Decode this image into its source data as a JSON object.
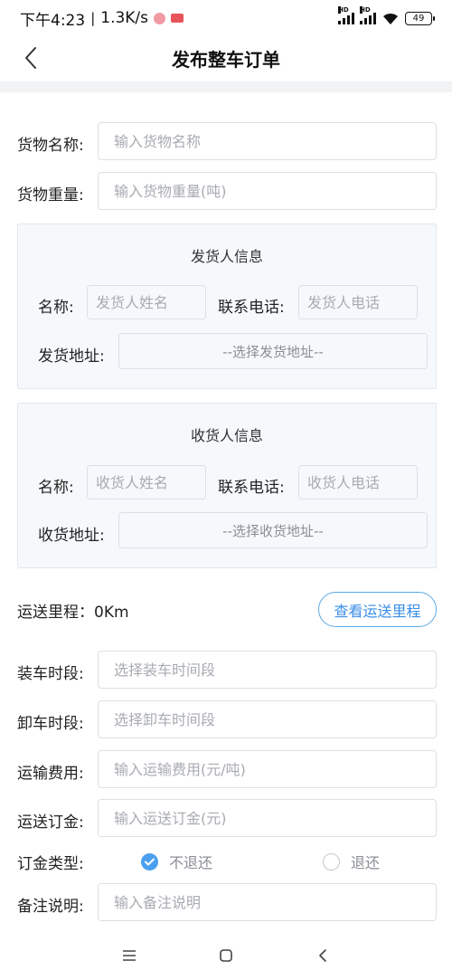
{
  "status_bar": {
    "time": "下午4:23",
    "speed": "1.3K/s",
    "battery": "49",
    "hd_label": "HD"
  },
  "header": {
    "title": "发布整车订单"
  },
  "form": {
    "cargo_name": {
      "label": "货物名称:",
      "placeholder": "输入货物名称"
    },
    "cargo_weight": {
      "label": "货物重量:",
      "placeholder": "输入货物重量(吨)"
    }
  },
  "shipper": {
    "title": "发货人信息",
    "name_label": "名称:",
    "name_placeholder": "发货人姓名",
    "phone_label": "联系电话:",
    "phone_placeholder": "发货人电话",
    "address_label": "发货地址:",
    "address_select": "--选择发货地址--"
  },
  "receiver": {
    "title": "收货人信息",
    "name_label": "名称:",
    "name_placeholder": "收货人姓名",
    "phone_label": "联系电话:",
    "phone_placeholder": "收货人电话",
    "address_label": "收货地址:",
    "address_select": "--选择收货地址--"
  },
  "distance": {
    "label": "运送里程：0Km",
    "button": "查看运送里程"
  },
  "schedule": {
    "loading": {
      "label": "装车时段:",
      "placeholder": "选择装车时间段"
    },
    "unloading": {
      "label": "卸车时段:",
      "placeholder": "选择卸车时间段"
    },
    "fee": {
      "label": "运输费用:",
      "placeholder": "输入运输费用(元/吨)"
    },
    "deposit": {
      "label": "运送订金:",
      "placeholder": "输入运送订金(元)"
    }
  },
  "deposit_type": {
    "label": "订金类型:",
    "options": [
      "不退还",
      "退还"
    ],
    "selected": "不退还"
  },
  "remark": {
    "label": "备注说明:",
    "placeholder": "输入备注说明"
  },
  "colors": {
    "accent": "#4b9ff0",
    "button_text": "#3a8ee6",
    "panel_bg": "#f6f9fc",
    "placeholder": "#a8abb2"
  }
}
